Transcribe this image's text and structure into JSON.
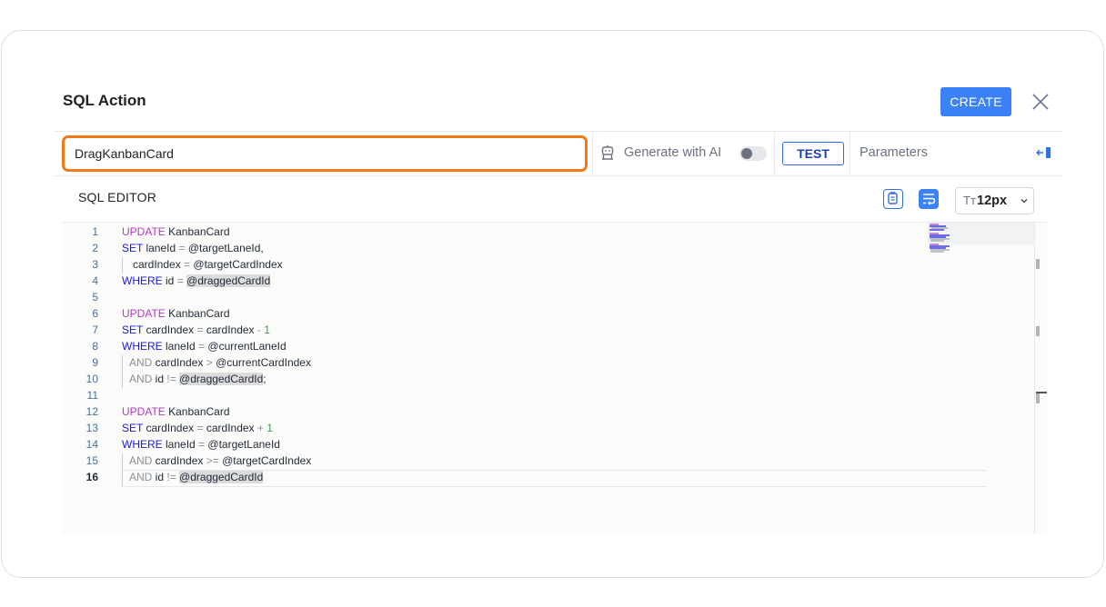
{
  "dialog": {
    "title": "SQL Action",
    "create_label": "CREATE"
  },
  "toolbar": {
    "action_name": "DragKanbanCard",
    "generate_ai_label": "Generate with AI",
    "generate_ai_enabled": false,
    "test_label": "TEST",
    "parameters_label": "Parameters"
  },
  "editor": {
    "header_label": "SQL EDITOR",
    "font_size_icon": "Tт",
    "font_size": "12px",
    "active_line": 16,
    "line_numbers": [
      "1",
      "2",
      "3",
      "4",
      "5",
      "6",
      "7",
      "8",
      "9",
      "10",
      "11",
      "12",
      "13",
      "14",
      "15",
      "16"
    ]
  },
  "code": {
    "l1_kw": "UPDATE",
    "l1_rest": " KanbanCard",
    "l2_kw": "SET",
    "l2_a": " laneId ",
    "l2_op": "=",
    "l2_b": " @targetLaneId,",
    "l3_a": "cardIndex ",
    "l3_op": "=",
    "l3_b": " @targetCardIndex",
    "l4_kw": "WHERE",
    "l4_a": " id ",
    "l4_op": "=",
    "l4_sp": " ",
    "l4_b": "@draggedCardId",
    "l6_kw": "UPDATE",
    "l6_rest": " KanbanCard",
    "l7_kw": "SET",
    "l7_a": " cardIndex ",
    "l7_op": "=",
    "l7_b": " cardIndex ",
    "l7_op2": "-",
    "l7_num": " 1",
    "l8_kw": "WHERE",
    "l8_a": " laneId ",
    "l8_op": "=",
    "l8_b": " @currentLaneId",
    "l9_kw": "AND",
    "l9_a": " cardIndex ",
    "l9_op": ">",
    "l9_b": " @currentCardIndex",
    "l10_kw": "AND",
    "l10_a": " id ",
    "l10_op": "!=",
    "l10_sp": " ",
    "l10_b": "@draggedCardId",
    "l10_end": ";",
    "l12_kw": "UPDATE",
    "l12_rest": " KanbanCard",
    "l13_kw": "SET",
    "l13_a": " cardIndex ",
    "l13_op": "=",
    "l13_b": " cardIndex ",
    "l13_op2": "+",
    "l13_num": " 1",
    "l14_kw": "WHERE",
    "l14_a": " laneId ",
    "l14_op": "=",
    "l14_b": " @targetLaneId",
    "l15_kw": "AND",
    "l15_a": " cardIndex ",
    "l15_op": ">=",
    "l15_b": " @targetCardIndex",
    "l16_kw": "AND",
    "l16_a": " id ",
    "l16_op": "!=",
    "l16_sp": " ",
    "l16_b": "@draggedCardId"
  },
  "colors": {
    "accent": "#3b82f6",
    "focus_border": "#f07a1a",
    "keyword_purple": "#b33cc4",
    "keyword_blue": "#1a1adb",
    "number_green": "#2f9e57"
  },
  "icons": {
    "close": "close-icon",
    "ai": "robot-icon",
    "collapse": "panel-collapse-icon",
    "copy": "copy-icon",
    "wrap": "word-wrap-icon",
    "chevron": "chevron-down-icon"
  }
}
